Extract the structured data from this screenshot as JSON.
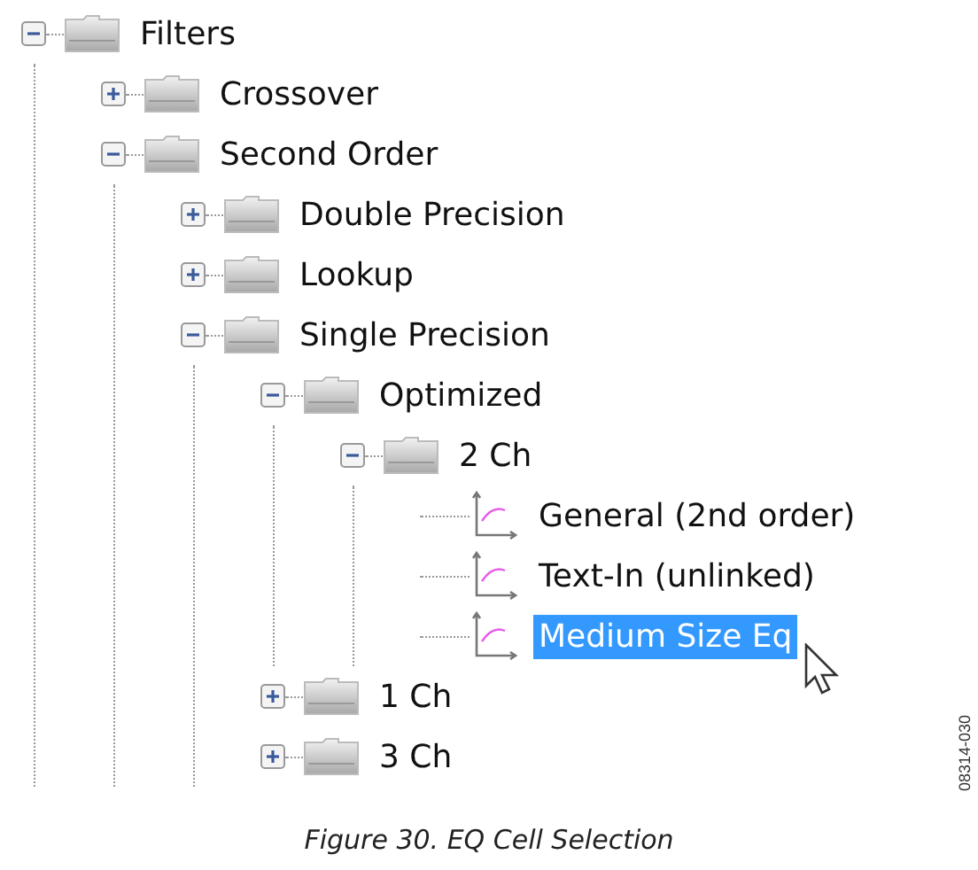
{
  "tree": {
    "items": [
      {
        "label": "Filters",
        "kind": "folder",
        "expanded": true,
        "selected": false,
        "children": [
          {
            "label": "Crossover",
            "kind": "folder",
            "expanded": false,
            "selected": false
          },
          {
            "label": "Second Order",
            "kind": "folder",
            "expanded": true,
            "selected": false,
            "children": [
              {
                "label": "Double Precision",
                "kind": "folder",
                "expanded": false,
                "selected": false
              },
              {
                "label": "Lookup",
                "kind": "folder",
                "expanded": false,
                "selected": false
              },
              {
                "label": "Single Precision",
                "kind": "folder",
                "expanded": true,
                "selected": false,
                "children": [
                  {
                    "label": "Optimized",
                    "kind": "folder",
                    "expanded": true,
                    "selected": false,
                    "children": [
                      {
                        "label": "2 Ch",
                        "kind": "folder",
                        "expanded": true,
                        "selected": false,
                        "children": [
                          {
                            "label": "General (2nd order)",
                            "kind": "cell",
                            "selected": false
                          },
                          {
                            "label": "Text-In (unlinked)",
                            "kind": "cell",
                            "selected": false
                          },
                          {
                            "label": "Medium Size Eq",
                            "kind": "cell",
                            "selected": true
                          }
                        ]
                      }
                    ]
                  },
                  {
                    "label": "1 Ch",
                    "kind": "folder",
                    "expanded": false,
                    "selected": false
                  },
                  {
                    "label": "3 Ch",
                    "kind": "folder",
                    "expanded": false,
                    "selected": false
                  }
                ]
              }
            ]
          }
        ]
      }
    ]
  },
  "caption": "Figure 30. EQ Cell Selection",
  "figure_code": "08314-030"
}
